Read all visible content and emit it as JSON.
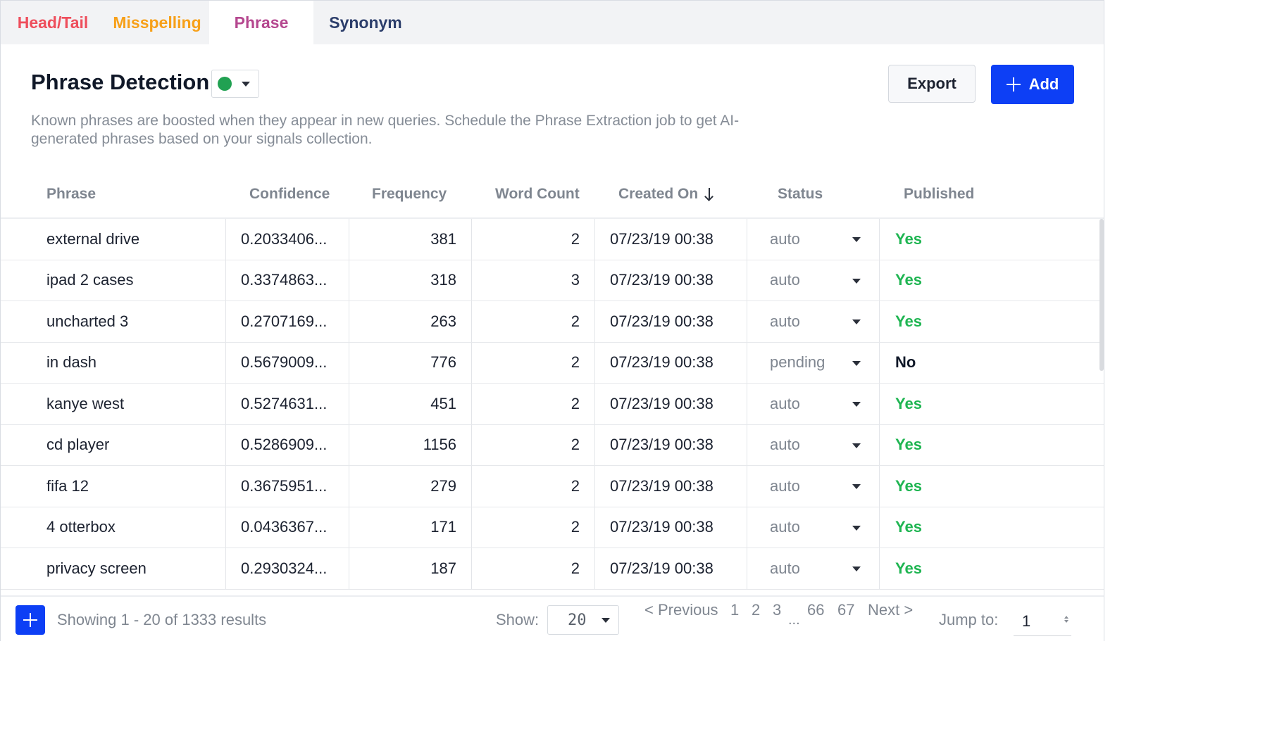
{
  "tabs": [
    {
      "label": "Head/Tail",
      "color": "#ee4e5c",
      "active": false
    },
    {
      "label": "Misspelling",
      "color": "#f7a019",
      "active": false
    },
    {
      "label": "Phrase",
      "color": "#b5478f",
      "active": true
    },
    {
      "label": "Synonym",
      "color": "#2c3e6b",
      "active": false
    }
  ],
  "header": {
    "title": "Phrase Detection",
    "status_color": "#21a152",
    "description": "Known phrases are boosted when they appear in new queries. Schedule the Phrase Extraction job to get AI-generated phrases based on your signals collection.",
    "export_label": "Export",
    "add_label": "Add",
    "add_color": "#0d3ff5"
  },
  "table": {
    "columns": [
      "Phrase",
      "Confidence",
      "Frequency",
      "Word Count",
      "Created On",
      "Status",
      "Published"
    ],
    "sorted_column": "Created On",
    "sort_direction": "descending",
    "yes_color": "#1fb552",
    "rows": [
      {
        "phrase": "external drive",
        "confidence": "0.2033406...",
        "frequency": "381",
        "word_count": "2",
        "created_on": "07/23/19 00:38",
        "status": "auto",
        "published": "Yes"
      },
      {
        "phrase": "ipad 2 cases",
        "confidence": "0.3374863...",
        "frequency": "318",
        "word_count": "3",
        "created_on": "07/23/19 00:38",
        "status": "auto",
        "published": "Yes"
      },
      {
        "phrase": "uncharted 3",
        "confidence": "0.2707169...",
        "frequency": "263",
        "word_count": "2",
        "created_on": "07/23/19 00:38",
        "status": "auto",
        "published": "Yes"
      },
      {
        "phrase": "in dash",
        "confidence": "0.5679009...",
        "frequency": "776",
        "word_count": "2",
        "created_on": "07/23/19 00:38",
        "status": "pending",
        "published": "No"
      },
      {
        "phrase": "kanye west",
        "confidence": "0.5274631...",
        "frequency": "451",
        "word_count": "2",
        "created_on": "07/23/19 00:38",
        "status": "auto",
        "published": "Yes"
      },
      {
        "phrase": "cd player",
        "confidence": "0.5286909...",
        "frequency": "1156",
        "word_count": "2",
        "created_on": "07/23/19 00:38",
        "status": "auto",
        "published": "Yes"
      },
      {
        "phrase": "fifa 12",
        "confidence": "0.3675951...",
        "frequency": "279",
        "word_count": "2",
        "created_on": "07/23/19 00:38",
        "status": "auto",
        "published": "Yes"
      },
      {
        "phrase": "4 otterbox",
        "confidence": "0.0436367...",
        "frequency": "171",
        "word_count": "2",
        "created_on": "07/23/19 00:38",
        "status": "auto",
        "published": "Yes"
      },
      {
        "phrase": "privacy screen",
        "confidence": "0.2930324...",
        "frequency": "187",
        "word_count": "2",
        "created_on": "07/23/19 00:38",
        "status": "auto",
        "published": "Yes"
      }
    ]
  },
  "footer": {
    "showing_text": "Showing 1 - 20 of 1333 results",
    "show_label": "Show:",
    "page_size": "20",
    "previous_label": "< Previous",
    "pages": [
      "1",
      "2",
      "3",
      "66",
      "67"
    ],
    "ellipsis": "...",
    "next_label": "Next >",
    "jump_label": "Jump to:",
    "jump_value": "1"
  }
}
